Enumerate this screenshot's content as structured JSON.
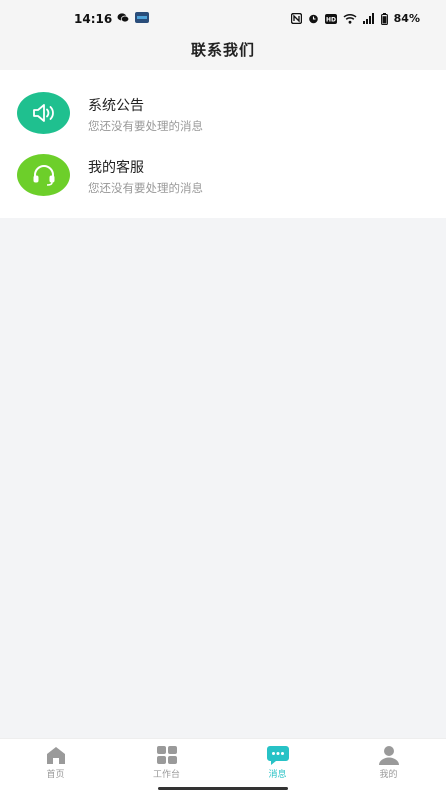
{
  "status_bar": {
    "time": "14:16",
    "battery": "84%"
  },
  "header": {
    "title": "联系我们"
  },
  "messages": [
    {
      "title": "系统公告",
      "subtitle": "您还没有要处理的消息",
      "icon": "speaker-icon",
      "color": "#1fc08f"
    },
    {
      "title": "我的客服",
      "subtitle": "您还没有要处理的消息",
      "icon": "headset-icon",
      "color": "#6dcf2a"
    }
  ],
  "bottom_nav": {
    "items": [
      {
        "label": "首页",
        "icon": "home-icon",
        "active": false
      },
      {
        "label": "工作台",
        "icon": "grid-icon",
        "active": false
      },
      {
        "label": "消息",
        "icon": "chat-icon",
        "active": true
      },
      {
        "label": "我的",
        "icon": "person-icon",
        "active": false
      }
    ],
    "active_color": "#27c2c6",
    "inactive_color": "#9a9a9a"
  }
}
